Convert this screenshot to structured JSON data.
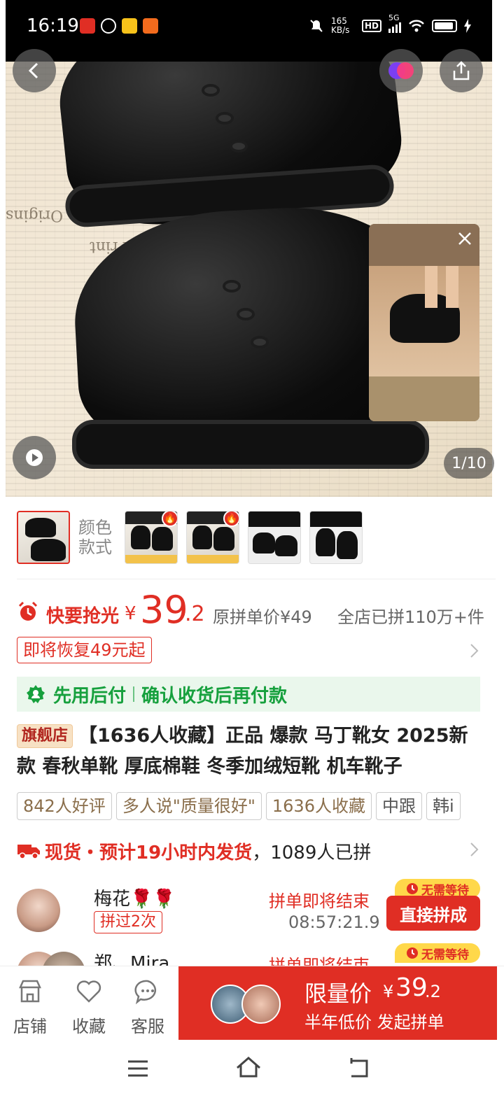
{
  "status_bar": {
    "time": "16:19",
    "speed": "165 KB/s",
    "hd": "HD",
    "net": "5G"
  },
  "gallery": {
    "counter": "1/10",
    "color_label_1": "颜色",
    "color_label_2": "款式"
  },
  "price": {
    "alarm_text": "快要抢光",
    "currency": "¥",
    "main": "39",
    "decimal": ".2",
    "original": "原拼单价¥49",
    "sold": "全店已拼110万+件",
    "restore": "即将恢复49元起"
  },
  "pay_later": {
    "left": "先用后付",
    "right": "确认收货后再付款"
  },
  "product": {
    "badge": "旗舰店",
    "title": "【1636人收藏】正品 爆款 马丁靴女 2025新款 春秋单靴 厚底棉鞋 冬季加绒短靴 机车靴子"
  },
  "chips": [
    "842人好评",
    "多人说\"质量很好\"",
    "1636人收藏",
    "中跟",
    "韩i"
  ],
  "shipping": {
    "highlight": "现货・预计19小时内发货",
    "rest": "，1089人已拼"
  },
  "groups": [
    {
      "name": "梅花🌹🌹",
      "tag": "拼过2次",
      "status": "拼单即将结束",
      "timer": "08:57:21.9",
      "button": "直接拼成",
      "no_wait": "无需等待"
    },
    {
      "name": "郑、Mira…",
      "status": "拼单即将结束",
      "no_wait": "无需等待"
    }
  ],
  "bottom_bar": {
    "store": "店铺",
    "favorite": "收藏",
    "service": "客服",
    "limit_label": "限量价",
    "currency": "¥",
    "limit_price": "39",
    "limit_decimal": ".2",
    "sub": "半年低价 发起拼单"
  },
  "colors": {
    "accent": "#e02e24",
    "green": "#16a03d",
    "gold": "#ffd84a"
  }
}
